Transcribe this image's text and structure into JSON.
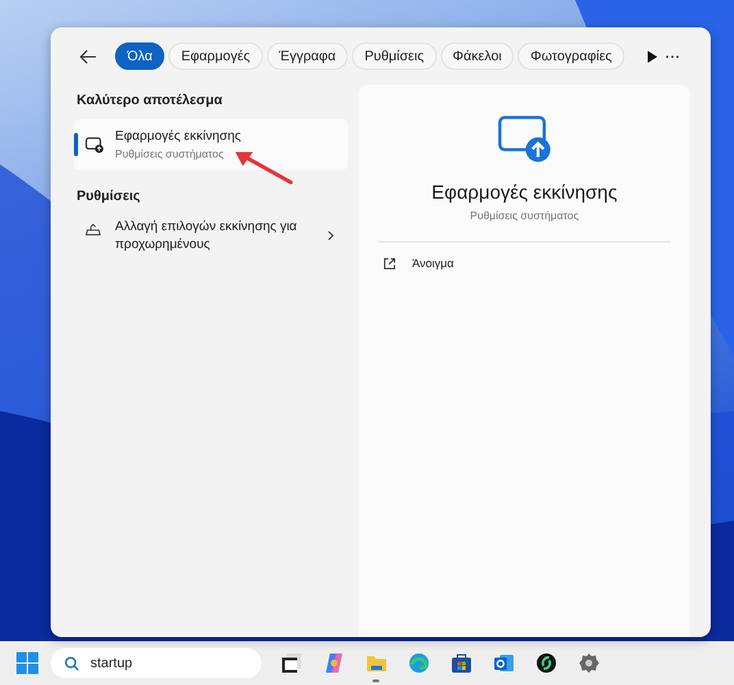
{
  "tabs": [
    {
      "label": "Όλα",
      "selected": true
    },
    {
      "label": "Εφαρμογές",
      "selected": false
    },
    {
      "label": "Έγγραφα",
      "selected": false
    },
    {
      "label": "Ρυθμίσεις",
      "selected": false
    },
    {
      "label": "Φάκελοι",
      "selected": false
    },
    {
      "label": "Φωτογραφίες",
      "selected": false
    }
  ],
  "best_match": {
    "heading": "Καλύτερο αποτέλεσμα",
    "result": {
      "title": "Εφαρμογές εκκίνησης",
      "subtitle": "Ρυθμίσεις συστήματος",
      "selected": true
    }
  },
  "settings": {
    "heading": "Ρυθμίσεις",
    "items": [
      {
        "title": "Αλλαγή επιλογών εκκίνησης για προχωρημένους"
      }
    ]
  },
  "preview": {
    "title": "Εφαρμογές εκκίνησης",
    "subtitle": "Ρυθμίσεις συστήματος",
    "actions": [
      {
        "label": "Άνοιγμα"
      }
    ]
  },
  "taskbar": {
    "search": {
      "value": "startup"
    },
    "apps": [
      {
        "kind": "taskview",
        "running": false
      },
      {
        "kind": "copilot",
        "running": false
      },
      {
        "kind": "explorer",
        "running": true
      },
      {
        "kind": "edge",
        "running": false
      },
      {
        "kind": "store",
        "running": false
      },
      {
        "kind": "outlook",
        "running": false
      },
      {
        "kind": "sync",
        "running": false
      },
      {
        "kind": "gear",
        "running": false
      }
    ]
  }
}
